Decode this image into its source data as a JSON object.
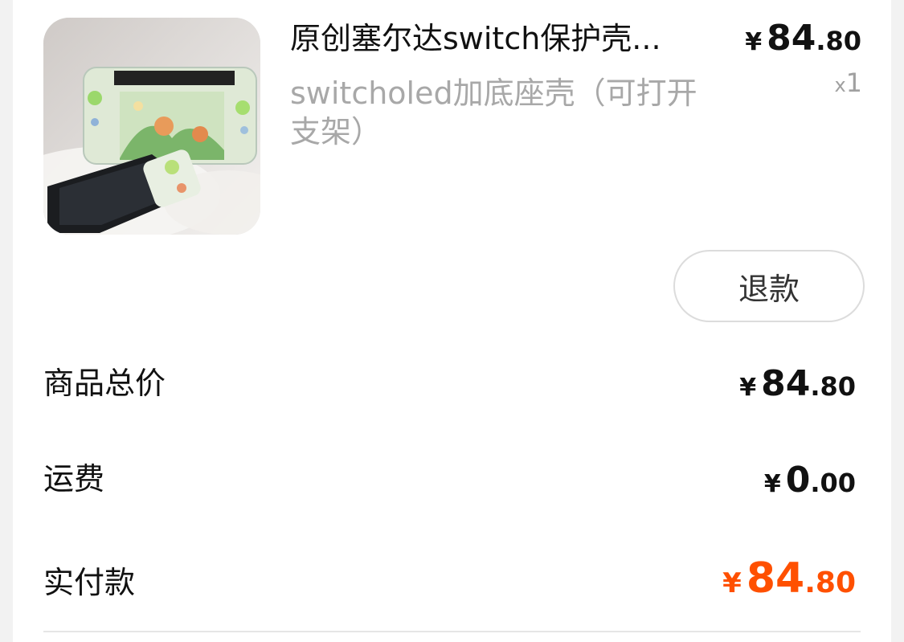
{
  "product": {
    "image_alt": "switch-case-photo",
    "title": "原创塞尔达switch保护壳...",
    "sku": "switcholed加底座壳（可打开支架）",
    "price": {
      "symbol": "¥",
      "integer": "84",
      "decimal": ".80"
    },
    "qty_prefix": "x",
    "qty": "1"
  },
  "actions": {
    "refund_label": "退款"
  },
  "summary": {
    "goods_total": {
      "label": "商品总价",
      "symbol": "¥",
      "integer": "84",
      "decimal": ".80"
    },
    "shipping": {
      "label": "运费",
      "symbol": "¥",
      "integer": "0",
      "decimal": ".00"
    },
    "paid": {
      "label": "实付款",
      "symbol": "¥",
      "integer": "84",
      "decimal": ".80"
    }
  },
  "colors": {
    "accent": "#ff5000",
    "text": "#111111",
    "muted": "#a8a8a8"
  }
}
